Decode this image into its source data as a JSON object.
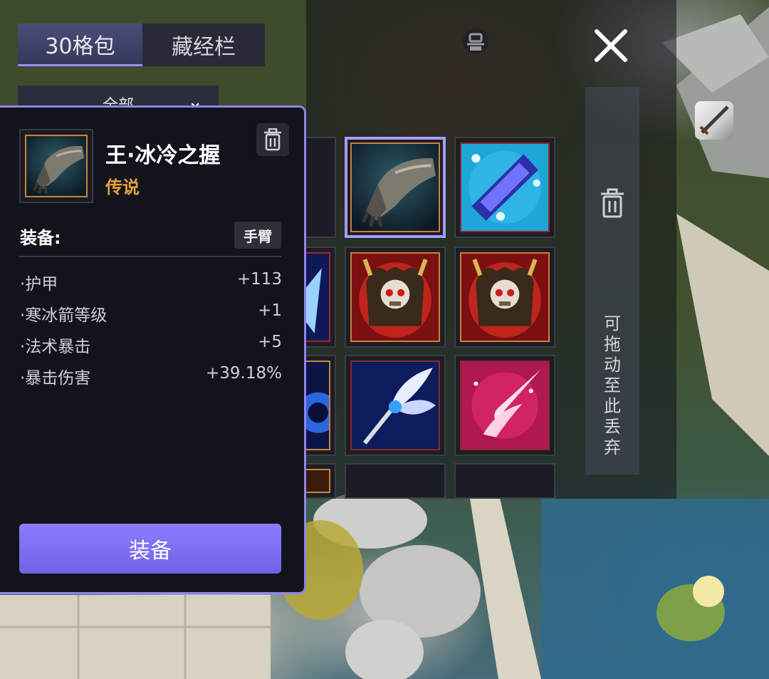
{
  "tabs": [
    {
      "label": "30格包",
      "active": true
    },
    {
      "label": "藏经栏",
      "active": false
    }
  ],
  "filter": {
    "label": "全部"
  },
  "discard": {
    "text": "可\n拖\n动\n至\n此\n丢\n弃"
  },
  "tooltip": {
    "name": "王·冰冷之握",
    "rarity": "传说",
    "rarity_color": "#e3a13c",
    "section_label": "装备:",
    "slot_type": "手臂",
    "stats": [
      {
        "name": "·护甲",
        "value": "+113"
      },
      {
        "name": "·寒冰箭等级",
        "value": "+1"
      },
      {
        "name": "·法术暴击",
        "value": "+5"
      },
      {
        "name": "·暴击伤害",
        "value": "+39.18%"
      }
    ],
    "equip_label": "装备"
  },
  "grid": [
    {
      "icon": "gauntlet-icon",
      "state": "selected"
    },
    {
      "icon": "ice-shard-icon",
      "state": "normal"
    },
    {
      "icon": "demon-armor-icon",
      "state": "normal"
    },
    {
      "icon": "demon-armor-icon",
      "state": "normal"
    },
    {
      "icon": "frost-staff-icon",
      "state": "normal"
    },
    {
      "icon": "crimson-spell-icon",
      "state": "normal"
    }
  ],
  "accent_color": "#8e84ee"
}
